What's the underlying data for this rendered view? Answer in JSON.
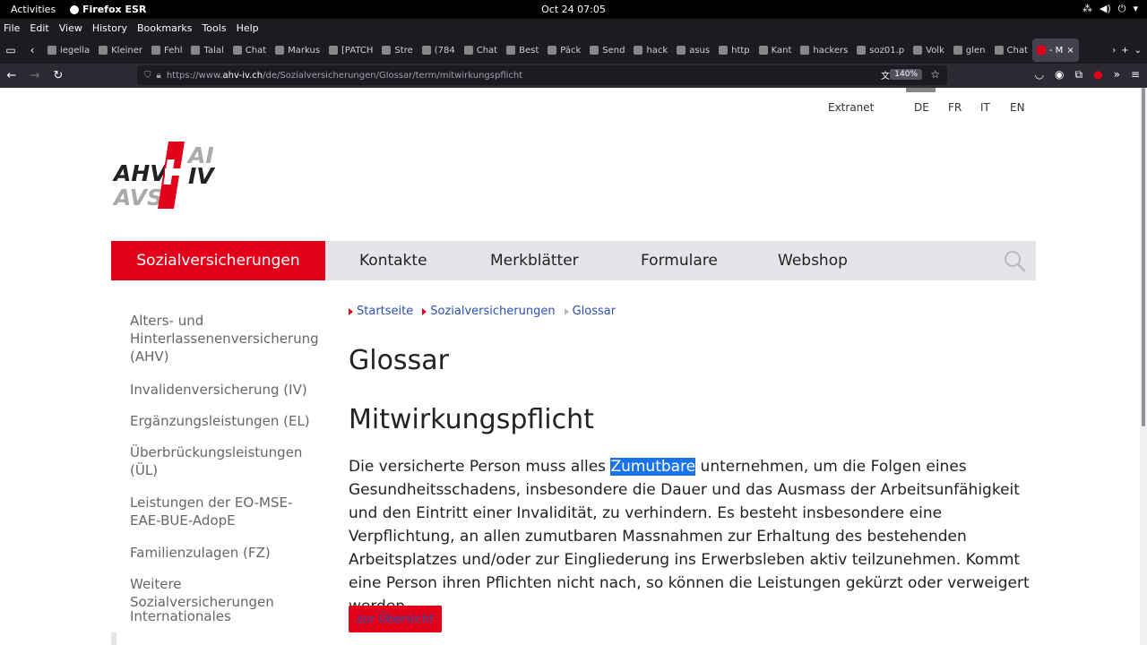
{
  "system": {
    "activities": "Activities",
    "app_name": "Firefox ESR",
    "clock": "Oct 24  07:05"
  },
  "menubar": {
    "items": [
      "File",
      "Edit",
      "View",
      "History",
      "Bookmarks",
      "Tools",
      "Help"
    ]
  },
  "tabs": {
    "items": [
      "iegella",
      "Kleiner",
      "Fehl",
      "Talal",
      "Chat",
      "Markus",
      "[PATCH",
      "Stre",
      "(784",
      "Chat",
      "Best",
      "Päck",
      "Send",
      "hack",
      "asus",
      "http",
      "Kant",
      "hackers",
      "soz01.p",
      "Volk",
      "glen",
      "Chat",
      "- M"
    ]
  },
  "navbar": {
    "url_prefix": "https://www.",
    "url_host": "ahv-iv.ch",
    "url_path": "/de/Sozialversicherungen/Glossar/term/mitwirkungspflicht",
    "zoom": "140%"
  },
  "page": {
    "toplinks": {
      "extranet": "Extranet",
      "langs": [
        "DE",
        "FR",
        "IT",
        "EN"
      ],
      "active_lang": "DE"
    },
    "logo": {
      "ahv": "AHV",
      "ai": "AI",
      "iv": "IV",
      "avs": "AVS"
    },
    "mainnav": {
      "items": [
        "Sozialversicherungen",
        "Kontakte",
        "Merkblätter",
        "Formulare",
        "Webshop"
      ]
    },
    "sidenav": {
      "items": [
        "Alters- und Hinterlassenenversicherung (AHV)",
        "Invalidenversicherung (IV)",
        "Ergänzungsleistungen (EL)",
        "Überbrückungsleistungen (ÜL)",
        "Leistungen der EO-MSE-EAE-BUE-AdopE",
        "Familienzulagen (FZ)",
        "Weitere Sozialversicherungen",
        "Internationales"
      ]
    },
    "breadcrumb": [
      "Startseite",
      "Sozialversicherungen",
      "Glossar"
    ],
    "heading": "Glossar",
    "term": "Mitwirkungspflicht",
    "body": {
      "before": "Die versicherte Person muss alles ",
      "highlight": "Zumutbare",
      "after": " unternehmen, um die Folgen eines Gesundheitsschadens, insbesondere die Dauer und das Ausmass der Arbeitsunfähigkeit und den Eintritt einer Invalidität, zu verhindern. Es besteht insbesondere eine Verpflichtung, an allen zumutbaren Massnahmen zur Erhaltung des bestehenden Arbeitsplatzes und/oder zur Eingliederung ins Erwerbsleben aktiv teilzunehmen. Kommt eine Person ihren Pflichten nicht nach, so können die Leistungen gekürzt oder verweigert werden."
    },
    "overview_button": "zur Übersicht"
  },
  "colors": {
    "brand_red": "#e3001b",
    "link_blue": "#2a4fb3",
    "nav_grey": "#e3e5e9"
  }
}
